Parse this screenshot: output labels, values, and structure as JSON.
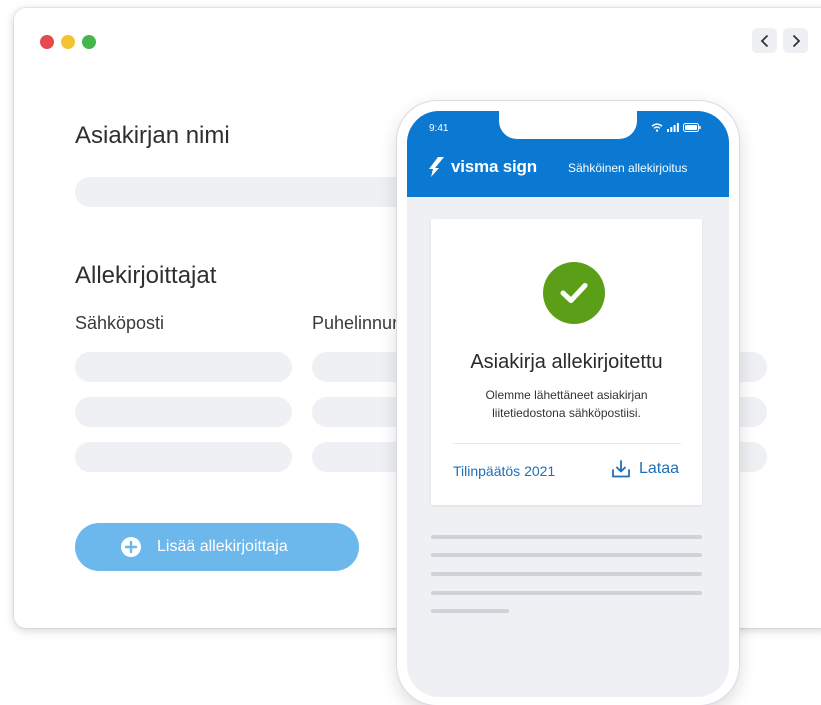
{
  "window": {
    "traffic_lights": {
      "close": "#e5484d",
      "minimize": "#f2c431",
      "zoom": "#45b649"
    },
    "nav": {
      "back_icon": "chevron-left-icon",
      "forward_icon": "chevron-right-icon"
    }
  },
  "form": {
    "document_name_label": "Asiakirjan nimi",
    "signers_label": "Allekirjoittajat",
    "email_column": "Sähköposti",
    "phone_column": "Puhelinnumero",
    "add_signer_label": "Lisää allekirjoittaja",
    "add_icon": "plus-circle-icon",
    "accent": "#6cb7ec"
  },
  "phone": {
    "time": "9:41",
    "brand_name": "visma sign",
    "brand_tagline": "Sähköinen allekirjoitus",
    "header_color": "#0b78d1",
    "card": {
      "status_icon": "check-icon",
      "status_color": "#5b9e17",
      "title": "Asiakirja allekirjoitettu",
      "message_line1": "Olemme lähettäneet asiakirjan",
      "message_line2": "liitetiedostona sähköpostiisi.",
      "file_name": "Tilinpäätös 2021",
      "download_label": "Lataa",
      "download_icon": "download-icon"
    }
  }
}
